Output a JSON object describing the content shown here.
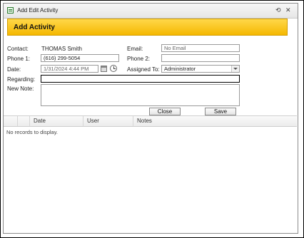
{
  "window": {
    "title": "Add Edit Activity",
    "refresh_glyph": "⟲",
    "close_glyph": "✕",
    "icon": "form-icon"
  },
  "banner": {
    "title": "Add Activity"
  },
  "form": {
    "contact_label": "Contact:",
    "contact_value": "THOMAS Smith",
    "email_label": "Email:",
    "email_value": "No Email",
    "phone1_label": "Phone 1:",
    "phone1_value": "(616) 299-5054",
    "phone2_label": "Phone 2:",
    "phone2_value": "",
    "date_label": "Date:",
    "date_value": "1/31/2024 4:44 PM",
    "assigned_label": "Assigned To:",
    "assigned_value": "Administrator",
    "regarding_label": "Regarding:",
    "regarding_value": "",
    "note_label": "New Note:",
    "note_value": ""
  },
  "buttons": {
    "close": "Close",
    "save": "Save"
  },
  "grid": {
    "columns": [
      "Date",
      "User",
      "Notes"
    ],
    "empty_message": "No records to display."
  }
}
